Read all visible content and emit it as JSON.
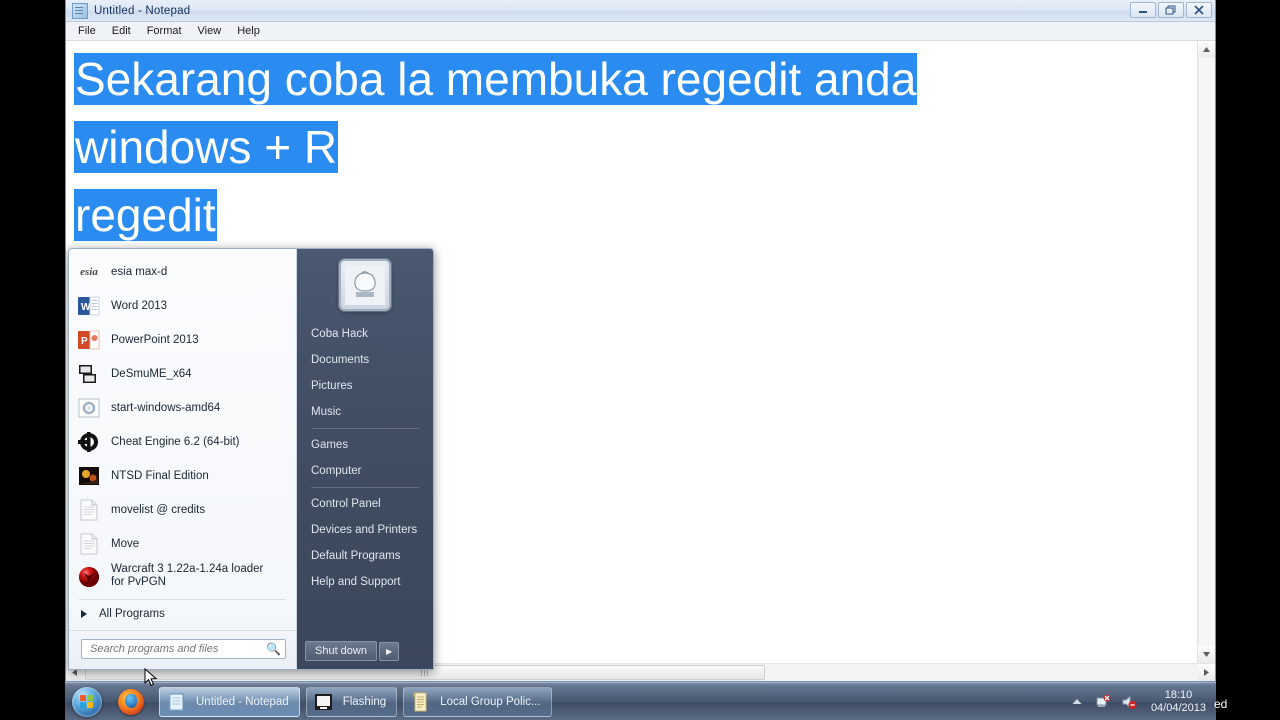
{
  "window": {
    "title": "Untitled - Notepad",
    "icon": "notepad-icon",
    "menus": [
      "File",
      "Edit",
      "Format",
      "View",
      "Help"
    ],
    "buttons": {
      "minimize": "minimize-icon",
      "restore": "restore-icon",
      "close": "close-icon"
    },
    "document": {
      "lines": [
        "Sekarang coba la membuka regedit anda",
        "windows + R",
        "regedit"
      ],
      "selection_color": "#2a8cf0",
      "selected_text_color": "#ffffff",
      "all_selected": true
    }
  },
  "start_menu": {
    "programs": [
      {
        "label": "esia max-d",
        "icon": "esia-icon"
      },
      {
        "label": "Word 2013",
        "icon": "word-icon"
      },
      {
        "label": "PowerPoint 2013",
        "icon": "powerpoint-icon"
      },
      {
        "label": "DeSmuME_x64",
        "icon": "desmume-icon"
      },
      {
        "label": "start-windows-amd64",
        "icon": "gear-icon"
      },
      {
        "label": "Cheat Engine 6.2 (64-bit)",
        "icon": "cheat-engine-icon"
      },
      {
        "label": "NTSD Final Edition",
        "icon": "ntsd-icon"
      },
      {
        "label": "movelist @ credits",
        "icon": "text-file-icon"
      },
      {
        "label": "Move",
        "icon": "text-file-icon"
      },
      {
        "label": "Warcraft 3 1.22a-1.24a loader for PvPGN",
        "icon": "warcraft-icon"
      }
    ],
    "all_programs": "All Programs",
    "search_placeholder": "Search programs and files",
    "search_value": "",
    "right_links": [
      "Coba Hack",
      "Documents",
      "Pictures",
      "Music",
      "Games",
      "Computer",
      "Control Panel",
      "Devices and Printers",
      "Default Programs",
      "Help and Support"
    ],
    "shutdown_label": "Shut down",
    "shutdown_arrow": "▶",
    "avatar": "user-avatar"
  },
  "taskbar": {
    "start_orb": "windows-start-orb",
    "pinned": [
      {
        "label": "Mozilla Firefox",
        "icon": "firefox-icon"
      }
    ],
    "tasks": [
      {
        "label": "Untitled - Notepad",
        "icon": "notepad-icon",
        "active": true
      },
      {
        "label": "Flashing",
        "icon": "folder-icon",
        "active": false
      },
      {
        "label": "Local Group Polic...",
        "icon": "gpedit-icon",
        "active": false
      }
    ],
    "tray": {
      "show_hidden": "chevron-up-icon",
      "network": "network-icon",
      "volume": "volume-muted-icon",
      "time": "18:10",
      "date": "04/04/2013"
    }
  },
  "overlay": {
    "clipped_text": "ed"
  }
}
